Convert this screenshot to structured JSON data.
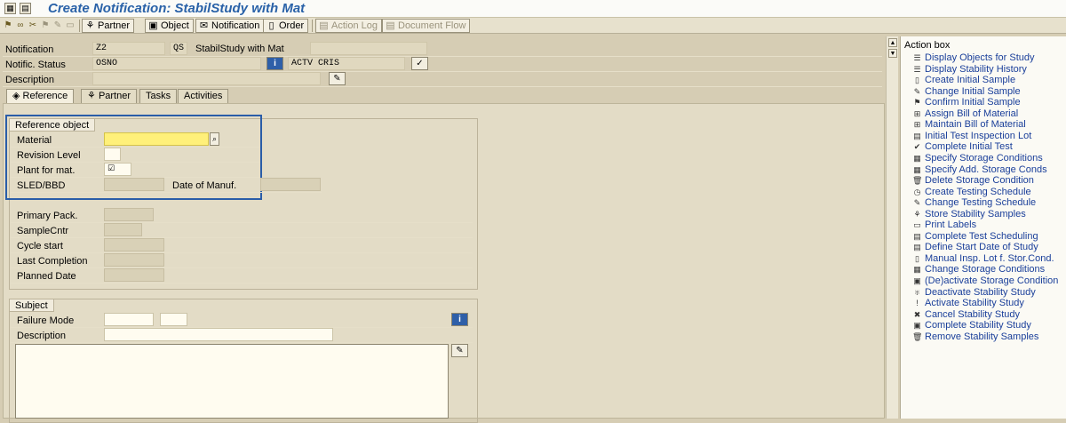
{
  "window": {
    "title": "Create Notification: StabilStudy with Mat"
  },
  "toolbar": {
    "buttons": [
      {
        "label": "Partner",
        "icon": "people-icon",
        "glyph": "⚘",
        "disabled": false
      },
      {
        "label": "Object",
        "icon": "object-icon",
        "glyph": "▣",
        "disabled": false
      },
      {
        "label": "Notification",
        "icon": "notification-icon",
        "glyph": "✉",
        "disabled": false
      },
      {
        "label": "Order",
        "icon": "document-icon",
        "glyph": "▯",
        "disabled": false
      },
      {
        "label": "Action Log",
        "icon": "action-log-icon",
        "glyph": "▤",
        "disabled": true
      },
      {
        "label": "Document Flow",
        "icon": "document-flow-icon",
        "glyph": "▤",
        "disabled": true
      }
    ]
  },
  "header": {
    "notification_label": "Notification",
    "notification_type": "Z2",
    "qs": "QS",
    "notification_text": "StabilStudy with Mat",
    "status_label": "Notific. Status",
    "status_value": "OSNO",
    "status_system": "ACTV CRIS",
    "description_label": "Description"
  },
  "tabs": [
    {
      "label": "Reference",
      "icon": "reference-icon",
      "glyph": "◈",
      "active": true
    },
    {
      "label": "Partner",
      "icon": "partner-icon",
      "glyph": "⚘",
      "active": false
    },
    {
      "label": "Tasks",
      "icon": "",
      "glyph": "",
      "active": false
    },
    {
      "label": "Activities",
      "icon": "",
      "glyph": "",
      "active": false
    }
  ],
  "reference": {
    "group_title": "Reference object",
    "material_label": "Material",
    "revision_label": "Revision Level",
    "plant_label": "Plant for mat.",
    "plant_checkbox": "☑",
    "sled_label": "SLED/BBD",
    "manuf_label": "Date of Manuf.",
    "primary_pack_label": "Primary Pack.",
    "sample_cntr_label": "SampleCntr",
    "cycle_start_label": "Cycle start",
    "last_completion_label": "Last Completion",
    "planned_date_label": "Planned Date"
  },
  "subject": {
    "group_title": "Subject",
    "failure_mode_label": "Failure Mode",
    "description_label": "Description"
  },
  "action_box": {
    "title": "Action box",
    "items": [
      {
        "label": "Display Objects for Study",
        "icon": "list-icon",
        "glyph": "☰"
      },
      {
        "label": "Display Stability History",
        "icon": "history-icon",
        "glyph": "☰"
      },
      {
        "label": "Create Initial Sample",
        "icon": "page-icon",
        "glyph": "▯"
      },
      {
        "label": "Change Initial Sample",
        "icon": "pencil-icon",
        "glyph": "✎"
      },
      {
        "label": "Confirm Initial Sample",
        "icon": "confirm-icon",
        "glyph": "⚑"
      },
      {
        "label": "Assign Bill of Material",
        "icon": "bom-icon",
        "glyph": "⊞"
      },
      {
        "label": "Maintain Bill of Material",
        "icon": "bom-icon",
        "glyph": "⊞"
      },
      {
        "label": "Initial Test Inspection Lot",
        "icon": "lot-icon",
        "glyph": "▤"
      },
      {
        "label": "Complete Initial Test",
        "icon": "complete-icon",
        "glyph": "✔"
      },
      {
        "label": "Specify Storage Conditions",
        "icon": "grid-icon",
        "glyph": "▦"
      },
      {
        "label": "Specify Add. Storage Conds",
        "icon": "grid-icon",
        "glyph": "▦"
      },
      {
        "label": "Delete Storage Condition",
        "icon": "trash-icon",
        "glyph": "🗑"
      },
      {
        "label": "Create Testing Schedule",
        "icon": "clock-icon",
        "glyph": "◷"
      },
      {
        "label": "Change Testing Schedule",
        "icon": "pencil-icon",
        "glyph": "✎"
      },
      {
        "label": "Store Stability Samples",
        "icon": "store-icon",
        "glyph": "⚘"
      },
      {
        "label": "Print Labels",
        "icon": "printer-icon",
        "glyph": "▭"
      },
      {
        "label": "Complete Test Scheduling",
        "icon": "calendar-icon",
        "glyph": "▤"
      },
      {
        "label": "Define Start Date of Study",
        "icon": "calendar-icon",
        "glyph": "▤"
      },
      {
        "label": "Manual Insp. Lot f. Stor.Cond.",
        "icon": "page-icon",
        "glyph": "▯"
      },
      {
        "label": "Change Storage Conditions",
        "icon": "grid-icon",
        "glyph": "▦"
      },
      {
        "label": "(De)activate Storage Condition",
        "icon": "storage-icon",
        "glyph": "▣"
      },
      {
        "label": "Deactivate Stability Study",
        "icon": "deactivate-icon",
        "glyph": "♅"
      },
      {
        "label": "Activate Stability Study",
        "icon": "activate-icon",
        "glyph": "!"
      },
      {
        "label": "Cancel Stability Study",
        "icon": "cancel-icon",
        "glyph": "✖"
      },
      {
        "label": "Complete Stability Study",
        "icon": "complete-study-icon",
        "glyph": "▣"
      },
      {
        "label": "Remove Stability Samples",
        "icon": "trash-icon",
        "glyph": "🗑"
      }
    ]
  }
}
